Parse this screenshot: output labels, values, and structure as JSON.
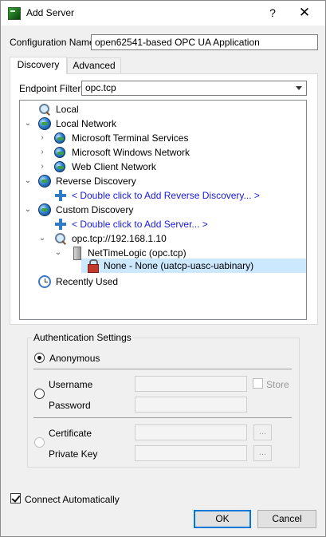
{
  "window": {
    "title": "Add Server",
    "help_glyph": "?",
    "close_glyph": "✕"
  },
  "config": {
    "label": "Configuration Name",
    "value": "open62541-based OPC UA Application"
  },
  "tabs": [
    {
      "label": "Discovery",
      "active": true
    },
    {
      "label": "Advanced",
      "active": false
    }
  ],
  "endpoint_filter": {
    "label": "Endpoint Filter:",
    "value": "opc.tcp"
  },
  "tree": {
    "local": {
      "label": "Local",
      "icon": "magnifier-icon"
    },
    "local_network": {
      "label": "Local Network",
      "icon": "globe-icon",
      "expanded": true
    },
    "ms_terminal": {
      "label": "Microsoft Terminal Services",
      "icon": "network-globe-icon"
    },
    "ms_windows": {
      "label": "Microsoft Windows Network",
      "icon": "network-globe-icon"
    },
    "web_client": {
      "label": "Web Client Network",
      "icon": "network-globe-icon"
    },
    "reverse_discovery": {
      "label": "Reverse Discovery",
      "icon": "globe-icon",
      "expanded": true
    },
    "add_reverse": {
      "label": "< Double click to Add Reverse Discovery... >",
      "icon": "plus-icon"
    },
    "custom_discovery": {
      "label": "Custom Discovery",
      "icon": "globe-icon",
      "expanded": true
    },
    "add_server": {
      "label": "< Double click to Add Server... >",
      "icon": "plus-icon"
    },
    "endpoint_url": {
      "label": "opc.tcp://192.168.1.10",
      "icon": "magnifier-icon"
    },
    "server": {
      "label": "NetTimeLogic  (opc.tcp)",
      "icon": "server-icon"
    },
    "security": {
      "label": "None - None (uatcp-uasc-uabinary)",
      "icon": "lock-icon",
      "selected": true
    },
    "recently_used": {
      "label": "Recently Used",
      "icon": "clock-icon"
    }
  },
  "auth": {
    "title": "Authentication Settings",
    "anonymous": "Anonymous",
    "username": "Username",
    "password": "Password",
    "store": "Store",
    "certificate": "Certificate",
    "private_key": "Private Key",
    "browse": "..."
  },
  "connect_auto": {
    "label": "Connect Automatically",
    "checked": true
  },
  "buttons": {
    "ok": "OK",
    "cancel": "Cancel"
  }
}
